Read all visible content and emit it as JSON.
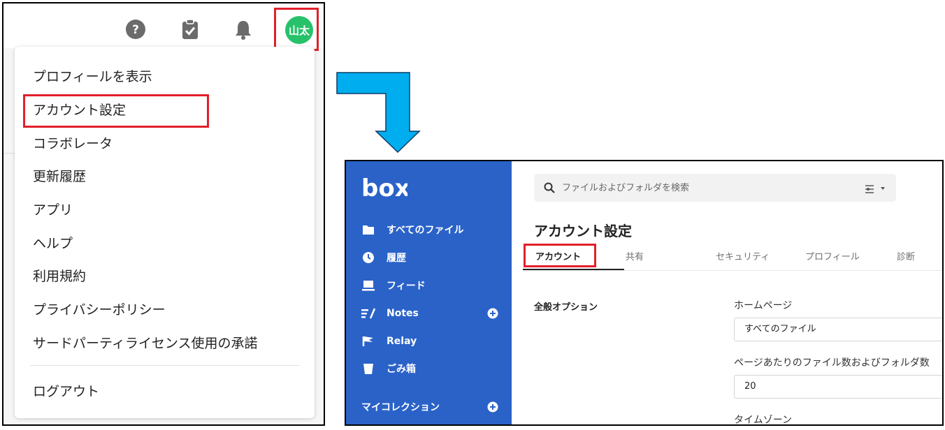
{
  "header": {
    "help_icon": "help-circle-icon",
    "tasks_icon": "clipboard-check-icon",
    "bell_icon": "bell-icon",
    "avatar_text": "山太",
    "avatar_color": "#27c16b"
  },
  "account_menu": {
    "items": [
      {
        "label": "プロフィールを表示"
      },
      {
        "label": "アカウント設定"
      },
      {
        "label": "コラボレータ"
      },
      {
        "label": "更新履歴"
      },
      {
        "label": "アプリ"
      },
      {
        "label": "ヘルプ"
      },
      {
        "label": "利用規約"
      },
      {
        "label": "プライバシーポリシー"
      },
      {
        "label": "サードパーティライセンス使用の承諾"
      }
    ],
    "logout_label": "ログアウト"
  },
  "highlight_color": "#e0202a",
  "arrow_color": "#00aeef",
  "box": {
    "logo_text": "box",
    "sidebar_color": "#2a62c8",
    "sidebar": {
      "items": [
        {
          "label": "すべてのファイル",
          "icon": "folder-icon"
        },
        {
          "label": "履歴",
          "icon": "clock-icon"
        },
        {
          "label": "フィード",
          "icon": "feed-icon"
        },
        {
          "label": "Notes",
          "icon": "notes-icon"
        },
        {
          "label": "Relay",
          "icon": "relay-flag-icon"
        },
        {
          "label": "ごみ箱",
          "icon": "trash-icon"
        }
      ],
      "collection_label": "マイコレクション"
    },
    "search": {
      "placeholder": "ファイルおよびフォルダを検索"
    },
    "page_title": "アカウント設定",
    "tabs": [
      {
        "label": "アカウント",
        "active": true
      },
      {
        "label": "共有"
      },
      {
        "label": "セキュリティ"
      },
      {
        "label": "プロフィール"
      },
      {
        "label": "診断"
      }
    ],
    "section_label": "全般オプション",
    "fields": {
      "home_page": {
        "label": "ホームページ",
        "value": "すべてのファイル"
      },
      "items_per_page": {
        "label": "ページあたりのファイル数およびフォルダ数",
        "value": "20"
      },
      "timezone": {
        "label": "タイムゾーン"
      }
    }
  }
}
